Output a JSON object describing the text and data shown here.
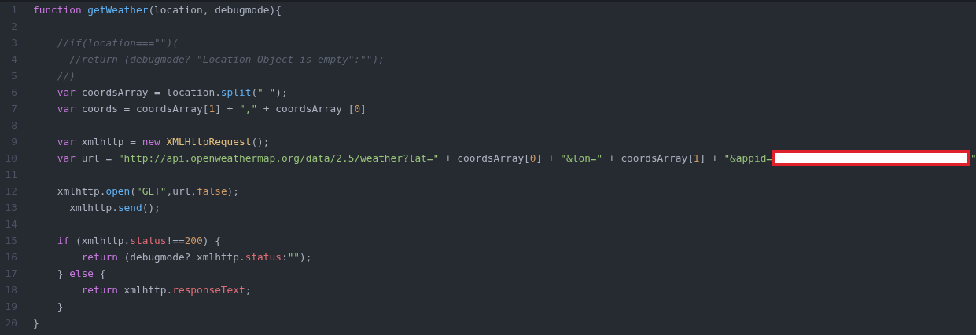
{
  "editor": {
    "lines": [
      {
        "number": "1",
        "tokens": [
          {
            "kind": "keyword",
            "text": "function "
          },
          {
            "kind": "function",
            "text": "getWeather"
          },
          {
            "kind": "plain",
            "text": "(location, debugmode){"
          }
        ]
      },
      {
        "number": "2"
      },
      {
        "number": "3",
        "tokens": [
          {
            "kind": "comment",
            "text": "    //if(location===\"\")("
          }
        ]
      },
      {
        "number": "4",
        "tokens": [
          {
            "kind": "comment",
            "text": "      //return (debugmode? \"Location Object is empty\":\"\");"
          }
        ]
      },
      {
        "number": "5",
        "tokens": [
          {
            "kind": "comment",
            "text": "    //)"
          }
        ]
      },
      {
        "number": "6",
        "tokens": [
          {
            "kind": "keyword",
            "text": "    var"
          },
          {
            "kind": "plain",
            "text": " coordsArray = location."
          },
          {
            "kind": "function",
            "text": "split"
          },
          {
            "kind": "plain",
            "text": "("
          },
          {
            "kind": "string",
            "text": "\" \""
          },
          {
            "kind": "plain",
            "text": ");"
          }
        ]
      },
      {
        "number": "7",
        "tokens": [
          {
            "kind": "keyword",
            "text": "    var"
          },
          {
            "kind": "plain",
            "text": " coords = coordsArray["
          },
          {
            "kind": "number",
            "text": "1"
          },
          {
            "kind": "plain",
            "text": "] + "
          },
          {
            "kind": "string",
            "text": "\",\""
          },
          {
            "kind": "plain",
            "text": " + coordsArray ["
          },
          {
            "kind": "number",
            "text": "0"
          },
          {
            "kind": "plain",
            "text": "]"
          }
        ]
      },
      {
        "number": "8"
      },
      {
        "number": "9",
        "tokens": [
          {
            "kind": "keyword",
            "text": "    var"
          },
          {
            "kind": "plain",
            "text": " xmlhttp = "
          },
          {
            "kind": "keyword",
            "text": "new "
          },
          {
            "kind": "class",
            "text": "XMLHttpRequest"
          },
          {
            "kind": "plain",
            "text": "();"
          }
        ]
      },
      {
        "number": "10",
        "tokens": [
          {
            "kind": "keyword",
            "text": "    var"
          },
          {
            "kind": "plain",
            "text": " url = "
          },
          {
            "kind": "string",
            "text": "\"http://api.openweathermap.org/data/2.5/weather?lat=\""
          },
          {
            "kind": "plain",
            "text": " + coordsArray["
          },
          {
            "kind": "number",
            "text": "0"
          },
          {
            "kind": "plain",
            "text": "] + "
          },
          {
            "kind": "string",
            "text": "\"&lon=\""
          },
          {
            "kind": "plain",
            "text": " + coordsArray["
          },
          {
            "kind": "number",
            "text": "1"
          },
          {
            "kind": "plain",
            "text": "] + "
          },
          {
            "kind": "string",
            "text": "\"&appid="
          }
        ],
        "redacted": true,
        "tail": [
          {
            "kind": "string",
            "text": "\""
          }
        ]
      },
      {
        "number": "11"
      },
      {
        "number": "12",
        "tokens": [
          {
            "kind": "plain",
            "text": "    xmlhttp."
          },
          {
            "kind": "function",
            "text": "open"
          },
          {
            "kind": "plain",
            "text": "("
          },
          {
            "kind": "string",
            "text": "\"GET\""
          },
          {
            "kind": "plain",
            "text": ",url,"
          },
          {
            "kind": "number",
            "text": "false"
          },
          {
            "kind": "plain",
            "text": ");"
          }
        ]
      },
      {
        "number": "13",
        "tokens": [
          {
            "kind": "plain",
            "text": "      xmlhttp."
          },
          {
            "kind": "function",
            "text": "send"
          },
          {
            "kind": "plain",
            "text": "();"
          }
        ]
      },
      {
        "number": "14"
      },
      {
        "number": "15",
        "tokens": [
          {
            "kind": "keyword",
            "text": "    if"
          },
          {
            "kind": "plain",
            "text": " (xmlhttp."
          },
          {
            "kind": "property",
            "text": "status"
          },
          {
            "kind": "plain",
            "text": "!=="
          },
          {
            "kind": "number",
            "text": "200"
          },
          {
            "kind": "plain",
            "text": ") {"
          }
        ]
      },
      {
        "number": "16",
        "tokens": [
          {
            "kind": "keyword",
            "text": "        return"
          },
          {
            "kind": "plain",
            "text": " (debugmode? xmlhttp."
          },
          {
            "kind": "property",
            "text": "status"
          },
          {
            "kind": "plain",
            "text": ":"
          },
          {
            "kind": "string",
            "text": "\"\""
          },
          {
            "kind": "plain",
            "text": ");"
          }
        ]
      },
      {
        "number": "17",
        "tokens": [
          {
            "kind": "plain",
            "text": "    } "
          },
          {
            "kind": "keyword",
            "text": "else"
          },
          {
            "kind": "plain",
            "text": " {"
          }
        ]
      },
      {
        "number": "18",
        "tokens": [
          {
            "kind": "keyword",
            "text": "        return"
          },
          {
            "kind": "plain",
            "text": " xmlhttp."
          },
          {
            "kind": "property",
            "text": "responseText"
          },
          {
            "kind": "plain",
            "text": ";"
          }
        ]
      },
      {
        "number": "19",
        "tokens": [
          {
            "kind": "plain",
            "text": "    }"
          }
        ]
      },
      {
        "number": "20",
        "tokens": [
          {
            "kind": "plain",
            "text": "}"
          }
        ]
      }
    ]
  }
}
